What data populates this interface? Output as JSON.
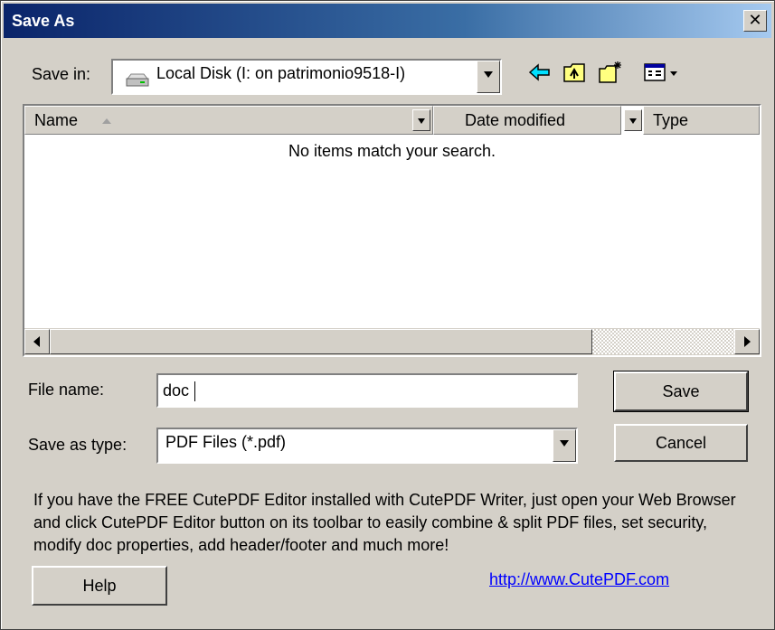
{
  "window": {
    "title": "Save As",
    "close_glyph": "✕"
  },
  "save_in": {
    "label": "Save in:",
    "value": "Local Disk (I: on patrimonio9518-I)",
    "icon": "drive-icon"
  },
  "toolbar": {
    "icons": [
      "back-arrow-icon",
      "up-folder-icon",
      "new-folder-icon",
      "view-menu-icon"
    ]
  },
  "filelist": {
    "columns": [
      "Name",
      "Date modified",
      "Type"
    ],
    "empty_message": "No items match your search."
  },
  "form": {
    "filename_label": "File name:",
    "filename_value": "doc",
    "type_label": "Save as type:",
    "type_value": "PDF Files (*.pdf)"
  },
  "buttons": {
    "save": "Save",
    "cancel": "Cancel",
    "help": "Help"
  },
  "info_text": "If you have the FREE CutePDF Editor installed with CutePDF Writer, just open your Web Browser and click CutePDF Editor button on its toolbar to easily combine & split PDF files, set security, modify doc properties, add header/footer and much more!",
  "link": "http://www.CutePDF.com",
  "colors": {
    "title_start": "#0a246a",
    "title_end": "#a6caf0",
    "face": "#d4d0c8",
    "link": "#0000ff"
  }
}
